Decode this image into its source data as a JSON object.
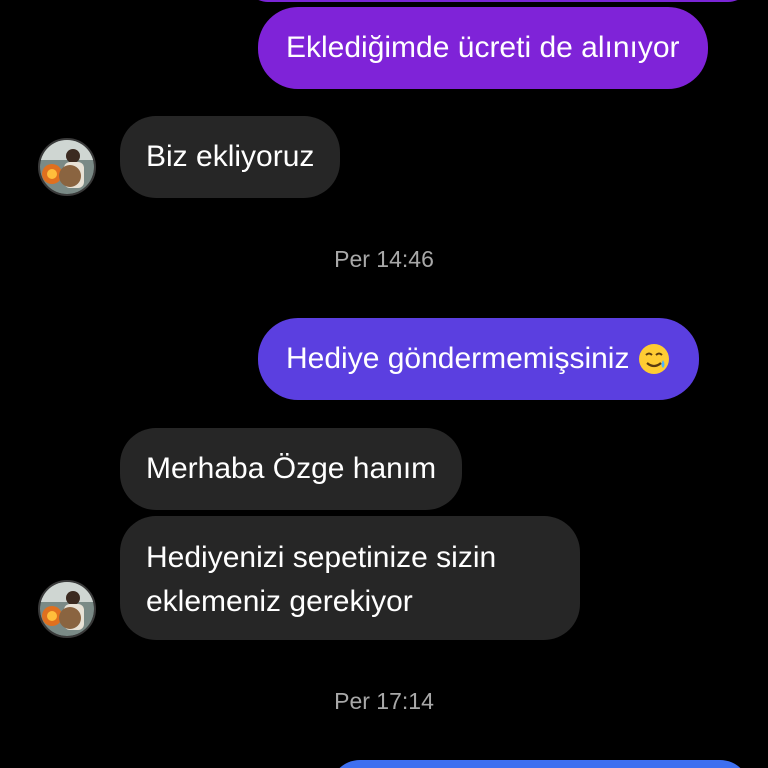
{
  "colors": {
    "background": "#000000",
    "sent_purple": "#7f23d8",
    "sent_indigo": "#5b3fe0",
    "sent_blue": "#3d6ff0",
    "received_bubble": "#262626",
    "timestamp_text": "#a8a8a8"
  },
  "messages": {
    "sent_1": "Eklediğimde ücreti de alınıyor",
    "received_1": "Biz ekliyoruz",
    "timestamp_1": "Per 14:46",
    "sent_2": "Hediye göndermemişsiniz",
    "sent_2_emoji": "smiling-face-with-tear-icon",
    "received_2": "Merhaba Özge hanım",
    "received_3_line1": "Hediyenizi sepetinize sizin",
    "received_3_line2": "eklemeniz gerekiyor",
    "timestamp_2": "Per 17:14"
  },
  "avatar": {
    "icon": "contact-avatar-icon"
  }
}
